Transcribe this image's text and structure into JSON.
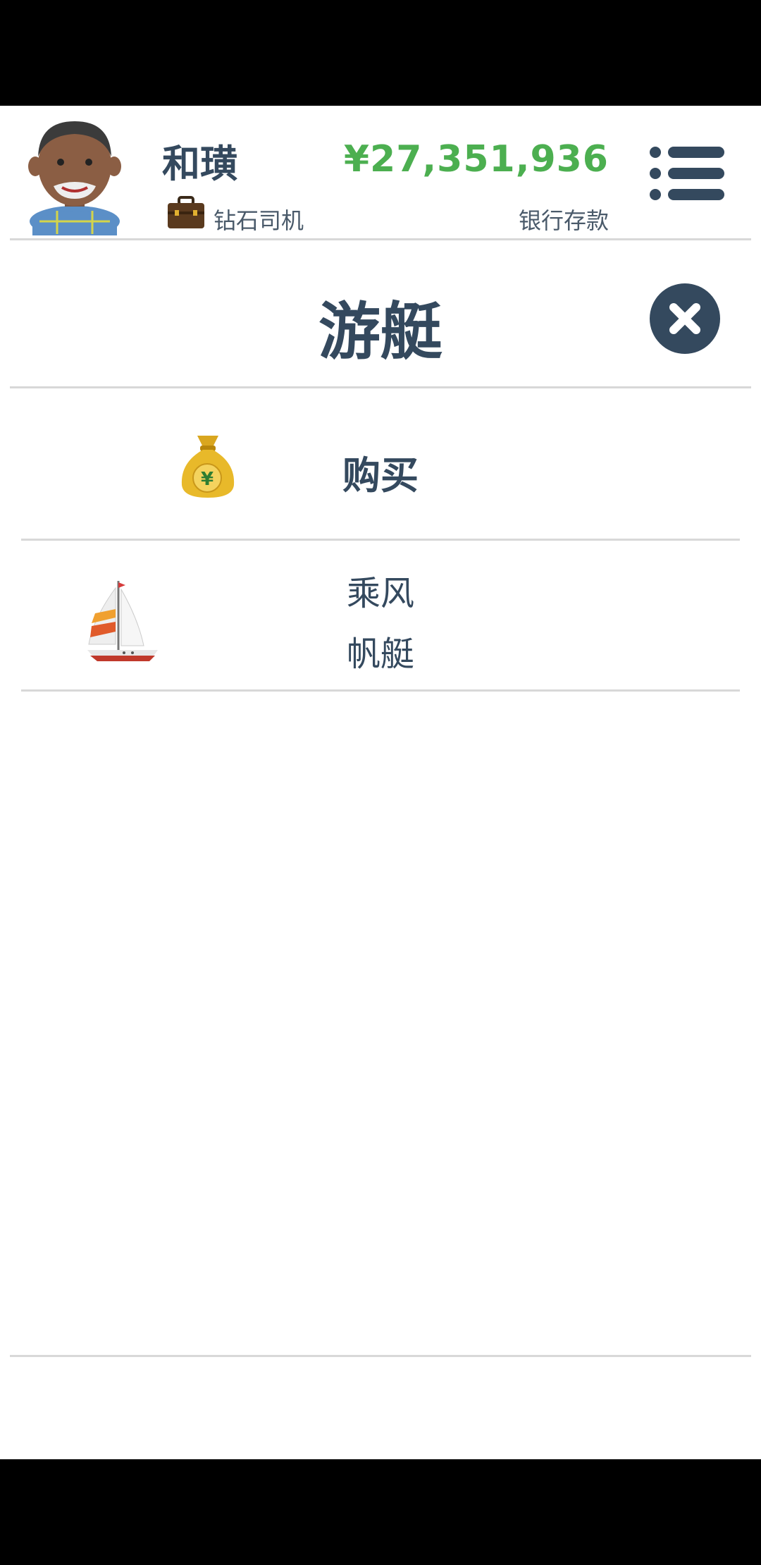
{
  "header": {
    "player_name": "和璜",
    "job_title": "钻石司机",
    "money": "¥27,351,936",
    "money_label": "银行存款"
  },
  "page": {
    "title": "游艇"
  },
  "rows": [
    {
      "label": "购买",
      "icon": "money-bag-icon"
    },
    {
      "line1": "乘风",
      "line2": "帆艇",
      "icon": "sailboat-icon"
    }
  ],
  "colors": {
    "primary": "#34495e",
    "money": "#4caf50",
    "divider": "#d8d8d8"
  }
}
